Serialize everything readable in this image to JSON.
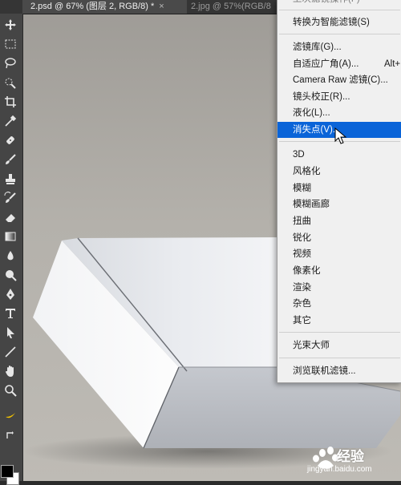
{
  "tabs": [
    {
      "label": "2.psd @ 67% (图层 2, RGB/8) *",
      "close": "×"
    },
    {
      "label": "2.jpg @ 57%(RGB/8"
    }
  ],
  "toolbar": {
    "tools": [
      "move-icon",
      "marquee-icon",
      "lasso-icon",
      "quick-select-icon",
      "crop-icon",
      "eyedropper-icon",
      "healing-brush-icon",
      "brush-icon",
      "clone-stamp-icon",
      "history-brush-icon",
      "eraser-icon",
      "gradient-icon",
      "blur-icon",
      "dodge-icon",
      "pen-icon",
      "type-icon",
      "path-select-icon",
      "line-icon",
      "hand-icon",
      "zoom-icon"
    ],
    "foreground_color": "#000000",
    "background_color": "#ffffff"
  },
  "menu": {
    "items": [
      {
        "label": "转换为智能滤镜(S)",
        "shortcut": ""
      },
      {
        "label": "滤镜库(G)...",
        "shortcut": ""
      },
      {
        "label": "自适应广角(A)...",
        "shortcut": "Alt+"
      },
      {
        "label": "Camera Raw 滤镜(C)...",
        "shortcut": ""
      },
      {
        "label": "镜头校正(R)...",
        "shortcut": ""
      },
      {
        "label": "液化(L)...",
        "shortcut": ""
      },
      {
        "label": "消失点(V)...",
        "shortcut": "",
        "highlighted": true
      },
      {
        "label": "3D",
        "shortcut": ""
      },
      {
        "label": "风格化",
        "shortcut": ""
      },
      {
        "label": "模糊",
        "shortcut": ""
      },
      {
        "label": "模糊画廊",
        "shortcut": ""
      },
      {
        "label": "扭曲",
        "shortcut": ""
      },
      {
        "label": "锐化",
        "shortcut": ""
      },
      {
        "label": "视频",
        "shortcut": ""
      },
      {
        "label": "像素化",
        "shortcut": ""
      },
      {
        "label": "渲染",
        "shortcut": ""
      },
      {
        "label": "杂色",
        "shortcut": ""
      },
      {
        "label": "其它",
        "shortcut": ""
      },
      {
        "label": "光束大师",
        "shortcut": ""
      },
      {
        "label": "浏览联机滤镜...",
        "shortcut": ""
      }
    ],
    "highlight_color": "#0a64d8"
  },
  "watermark": {
    "text": "经验",
    "url": "jingyan.baidu.com"
  }
}
